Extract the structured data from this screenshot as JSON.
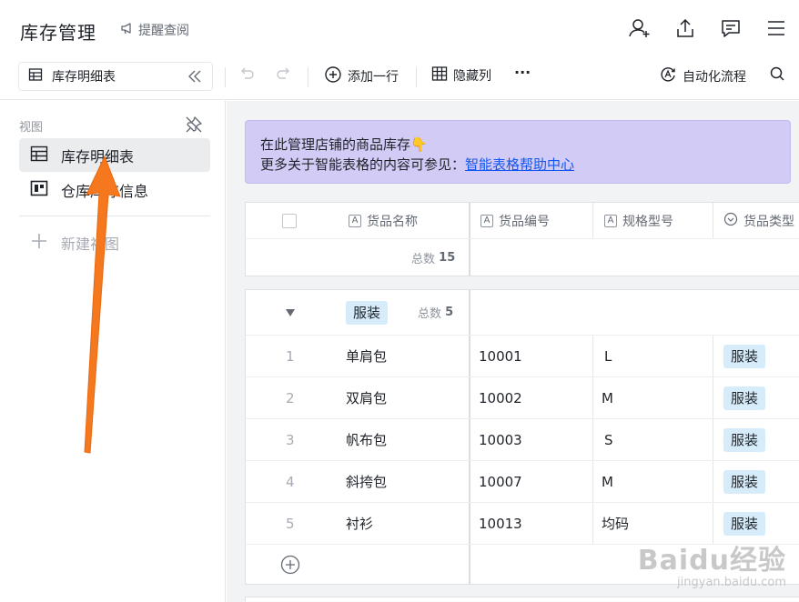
{
  "header": {
    "title": "库存管理",
    "remind_label": "提醒查阅",
    "icons": [
      "add-member-icon",
      "share-icon",
      "comment-icon",
      "menu-icon"
    ]
  },
  "toolbar": {
    "view_name": "库存明细表",
    "add_row_label": "添加一行",
    "hide_columns_label": "隐藏列",
    "more_label": "···",
    "automation_label": "自动化流程"
  },
  "sidebar": {
    "section_label": "视图",
    "items": [
      {
        "label": "库存明细表",
        "icon": "grid-view-icon",
        "active": true
      },
      {
        "label": "仓库库存信息",
        "icon": "kanban-view-icon",
        "active": false
      }
    ],
    "new_view_label": "新建视图"
  },
  "notice": {
    "line1": "在此管理店铺的商品库存",
    "emoji": "👇",
    "line2_prefix": "更多关于智能表格的内容可参见：",
    "link_text": "智能表格帮助中心"
  },
  "table": {
    "columns": [
      "货品名称",
      "货品编号",
      "规格型号",
      "货品类型"
    ],
    "total_label": "总数",
    "total_count": "15",
    "group": {
      "name": "服装",
      "count_label": "总数",
      "count": "5",
      "rows": [
        {
          "num": "1",
          "name": "单肩包",
          "code": "10001",
          "spec": "L",
          "type": "服装"
        },
        {
          "num": "2",
          "name": "双肩包",
          "code": "10002",
          "spec": "M",
          "type": "服装"
        },
        {
          "num": "3",
          "name": "帆布包",
          "code": "10003",
          "spec": "S",
          "type": "服装"
        },
        {
          "num": "4",
          "name": "斜挎包",
          "code": "10007",
          "spec": "M",
          "type": "服装"
        },
        {
          "num": "5",
          "name": "衬衫",
          "code": "10013",
          "spec": "均码",
          "type": "服装"
        }
      ]
    }
  },
  "watermark": {
    "brand": "Baidu经验",
    "url": "jingyan.baidu.com"
  },
  "colors": {
    "notice_bg": "#d2cbf5",
    "link": "#1456f0",
    "tag_bg": "#d6ecfb",
    "arrow": "#f5781e"
  }
}
